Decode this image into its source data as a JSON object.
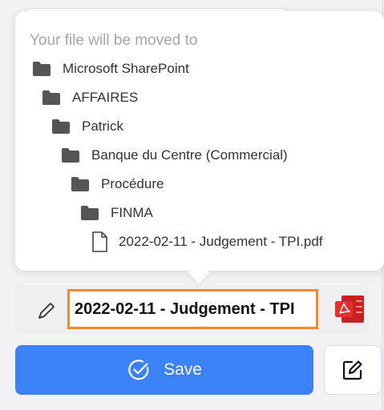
{
  "destination_popover": {
    "title": "Your file will be moved to",
    "path": [
      {
        "label": "Microsoft SharePoint",
        "type": "folder"
      },
      {
        "label": "AFFAIRES",
        "type": "folder"
      },
      {
        "label": "Patrick",
        "type": "folder"
      },
      {
        "label": "Banque du Centre (Commercial)",
        "type": "folder"
      },
      {
        "label": "Procédure",
        "type": "folder"
      },
      {
        "label": "FINMA",
        "type": "folder"
      },
      {
        "label": "2022-02-11 - Judgement - TPI.pdf",
        "type": "file"
      }
    ]
  },
  "file_name": {
    "value": "2022-02-11 - Judgement - TPI",
    "edit_icon": "pencil-icon",
    "file_type_icon": "pdf-icon"
  },
  "actions": {
    "save_label": "Save",
    "save_icon": "check-circle-icon",
    "edit_icon": "edit-square-icon"
  },
  "colors": {
    "primary": "#3b82f6",
    "focus_border": "#f18a2c",
    "pdf_red": "#e3302f",
    "folder": "#555555",
    "muted_text": "#a6a6aa"
  }
}
